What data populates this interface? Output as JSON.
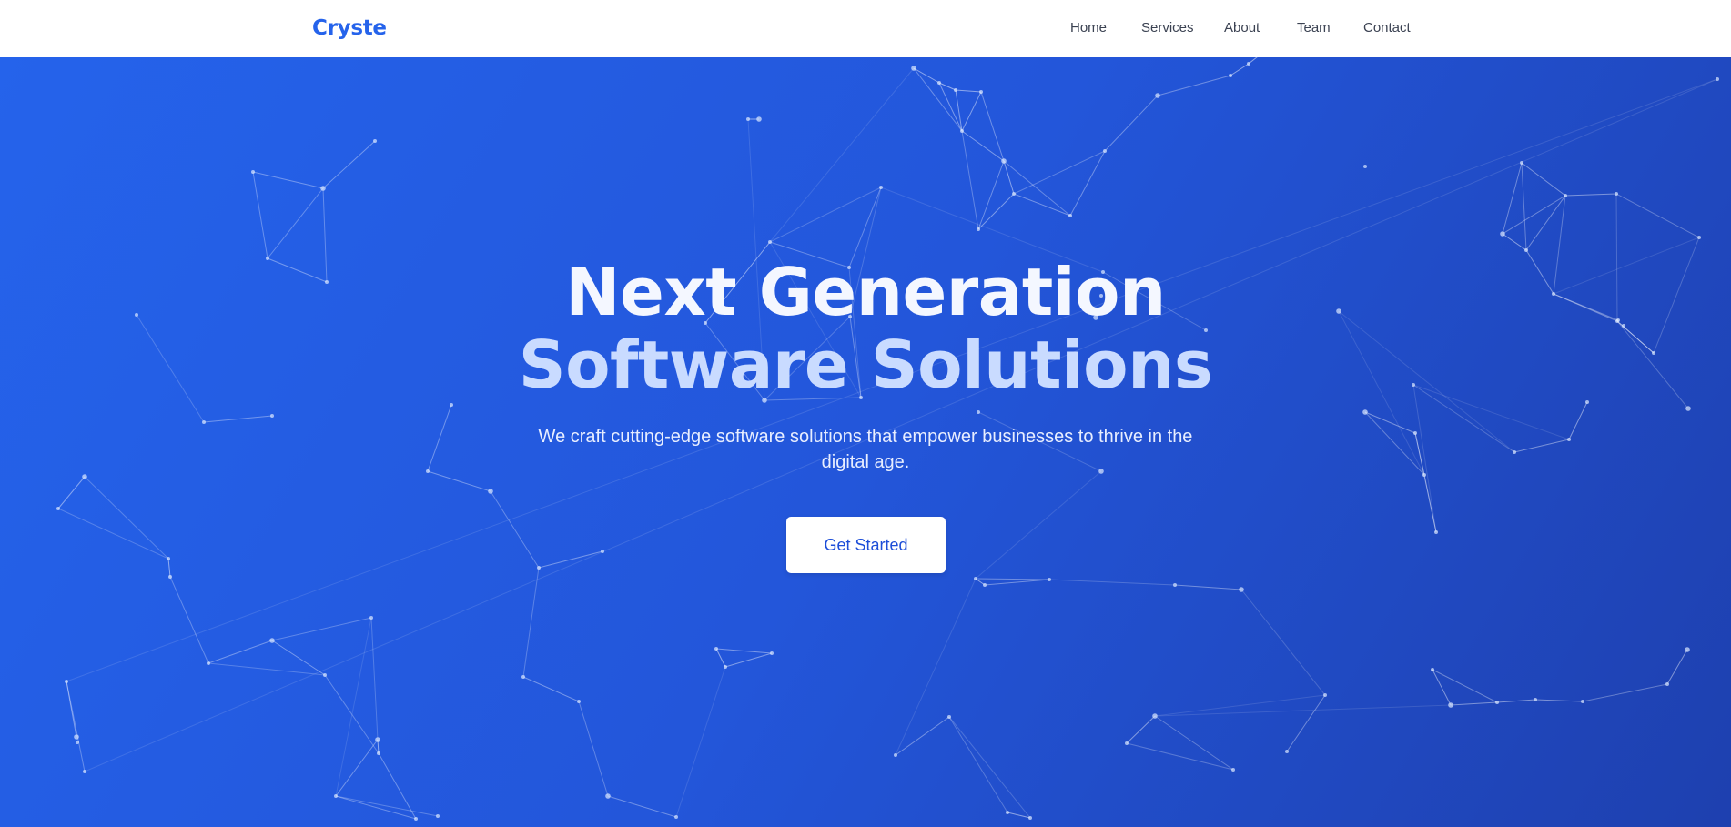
{
  "brand": {
    "name": "Cryste"
  },
  "nav": {
    "items": [
      {
        "label": "Home"
      },
      {
        "label": "Services"
      },
      {
        "label": "About"
      },
      {
        "label": "Team"
      },
      {
        "label": "Contact"
      }
    ]
  },
  "hero": {
    "headline_line1": "Next Generation",
    "headline_line2": "Software Solutions",
    "subtitle": "We craft cutting-edge software solutions that empower businesses to thrive in the digital age.",
    "cta_label": "Get Started"
  },
  "colors": {
    "brand": "#2563eb",
    "hero_gradient_start": "#2563eb",
    "hero_gradient_end": "#1e40af",
    "button_bg": "#ffffff",
    "button_text": "#1d4ed8"
  },
  "decoration": {
    "background": "particle-network"
  }
}
